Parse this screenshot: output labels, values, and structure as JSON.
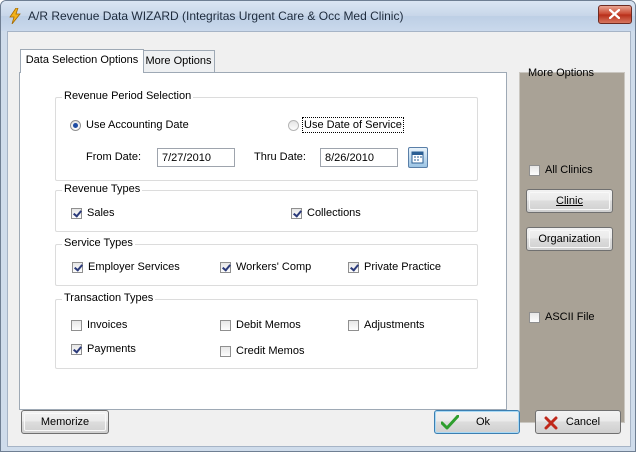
{
  "window": {
    "title": "A/R Revenue Data WIZARD (Integritas Urgent Care & Occ Med Clinic)"
  },
  "tabs": [
    {
      "label": "Data Selection Options",
      "selected": true
    },
    {
      "label": "More Options",
      "selected": false
    }
  ],
  "revenue_period": {
    "title": "Revenue Period Selection",
    "use_accounting_date": "Use Accounting Date",
    "use_date_of_service": "Use Date of Service",
    "selected": "Use Accounting Date",
    "from_label": "From Date:",
    "from_value": "7/27/2010",
    "thru_label": "Thru Date:",
    "thru_value": "8/26/2010"
  },
  "revenue_types": {
    "title": "Revenue Types",
    "sales": {
      "label": "Sales",
      "checked": true
    },
    "collections": {
      "label": "Collections",
      "checked": true
    }
  },
  "service_types": {
    "title": "Service Types",
    "employer": {
      "label": "Employer Services",
      "checked": true
    },
    "workers_comp": {
      "label": "Workers' Comp",
      "checked": true
    },
    "private_practice": {
      "label": "Private Practice",
      "checked": true
    }
  },
  "transaction_types": {
    "title": "Transaction Types",
    "invoices": {
      "label": "Invoices",
      "checked": false
    },
    "debit_memos": {
      "label": "Debit Memos",
      "checked": false
    },
    "adjustments": {
      "label": "Adjustments",
      "checked": false
    },
    "payments": {
      "label": "Payments",
      "checked": true
    },
    "credit_memos": {
      "label": "Credit Memos",
      "checked": false
    }
  },
  "more_options": {
    "title": "More Options",
    "all_clinics": {
      "label": "All Clinics",
      "checked": false
    },
    "clinic_button": "Clinic",
    "organization_button": "Organization",
    "ascii_file": {
      "label": "ASCII File",
      "checked": false
    }
  },
  "footer": {
    "memorize_button": "Memorize",
    "ok_button": "Ok",
    "cancel_button": "Cancel"
  },
  "colors": {
    "side_panel": "#a9a296",
    "ok_check": "#2e9e2e",
    "cancel_x": "#c0281a"
  }
}
